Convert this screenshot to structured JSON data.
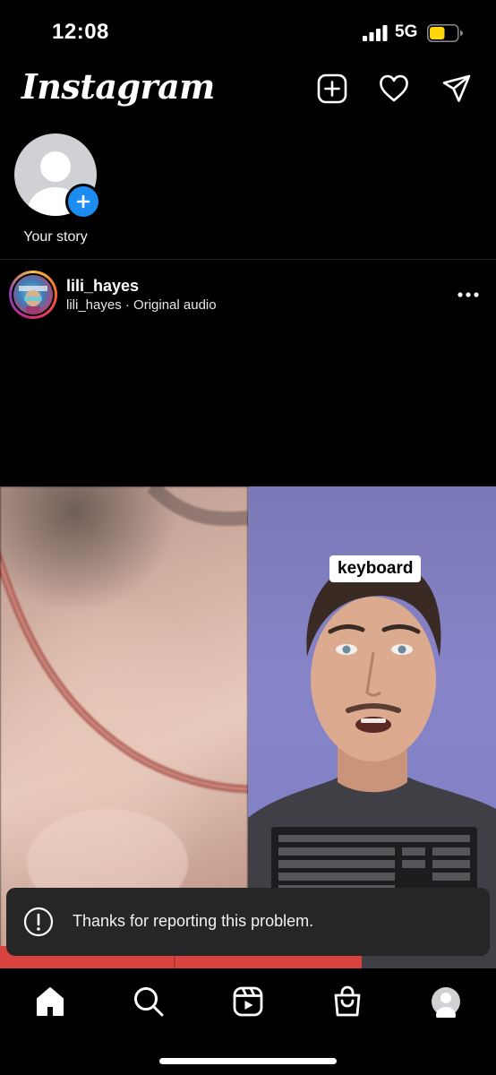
{
  "status_bar": {
    "time": "12:08",
    "network": "5G",
    "battery_level": 0.55,
    "battery_color": "#ffd60a"
  },
  "header": {
    "logo": "Instagram",
    "icons": [
      "new-post-icon",
      "heart-icon",
      "direct-message-icon"
    ]
  },
  "stories": {
    "own_label": "Your story"
  },
  "post": {
    "username": "lili_hayes",
    "subtitle": "lili_hayes · Original audio",
    "media_caption": "keyboard"
  },
  "toast": {
    "message": "Thanks for reporting this problem."
  },
  "bottom_nav": {
    "items": [
      "home-icon",
      "search-icon",
      "reels-icon",
      "shop-icon",
      "profile-avatar"
    ],
    "active": "home-icon"
  },
  "colors": {
    "background": "#000000",
    "accent_blue": "#1d8cf0",
    "toast_bg": "#262626"
  }
}
